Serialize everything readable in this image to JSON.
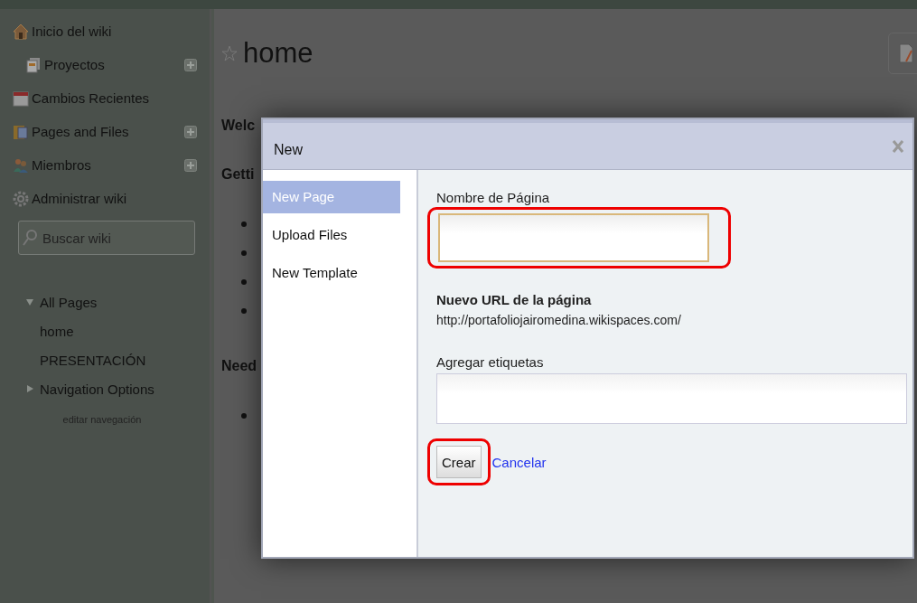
{
  "sidebar": {
    "nav": [
      {
        "label": "Inicio del wiki",
        "addable": false,
        "children": [
          {
            "label": "Proyectos",
            "addable": true
          }
        ]
      },
      {
        "label": "Cambios Recientes",
        "addable": false
      },
      {
        "label": "Pages and Files",
        "addable": true
      },
      {
        "label": "Miembros",
        "addable": true
      },
      {
        "label": "Administrar wiki",
        "addable": false
      }
    ],
    "search": {
      "placeholder": "Buscar wiki"
    },
    "pages": [
      {
        "label": "All Pages",
        "expanded": true,
        "children": [
          {
            "label": "home"
          },
          {
            "label": "PRESENTACIÓN"
          }
        ]
      },
      {
        "label": "Navigation Options",
        "expanded": false
      }
    ],
    "edit_link": "editar navegación"
  },
  "main": {
    "title": "home",
    "content": [
      {
        "kind": "heading",
        "text": "Welc"
      },
      {
        "kind": "heading",
        "text": "Getti"
      },
      {
        "kind": "bullet"
      },
      {
        "kind": "bullet"
      },
      {
        "kind": "bullet"
      },
      {
        "kind": "bullet"
      },
      {
        "kind": "heading",
        "text": "Need"
      },
      {
        "kind": "bullet"
      }
    ]
  },
  "dialog": {
    "title": "New",
    "tabs": [
      {
        "label": "New Page",
        "selected": true
      },
      {
        "label": "Upload Files",
        "selected": false
      },
      {
        "label": "New Template",
        "selected": false
      }
    ],
    "name_label": "Nombre de Página",
    "name_highlighted": true,
    "url_label": "Nuevo URL de la página",
    "url_value": "http://portafoliojairomedina.wikispaces.com/",
    "tags_label": "Agregar etiquetas",
    "create_button": "Crear",
    "create_highlighted": true,
    "cancel_link": "Cancelar"
  }
}
